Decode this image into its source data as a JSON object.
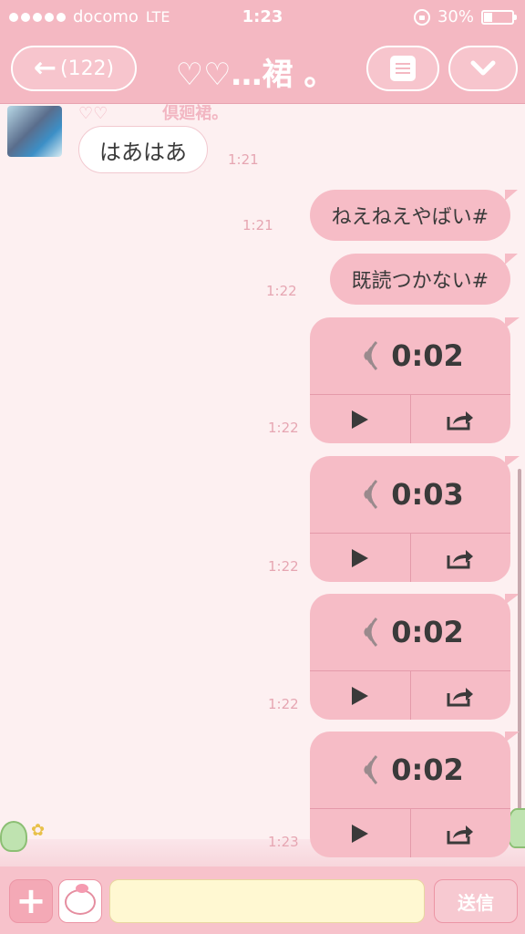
{
  "status_bar": {
    "carrier": "docomo",
    "network": "LTE",
    "time": "1:23",
    "battery": "30%",
    "battery_level": 0.3
  },
  "nav": {
    "back_label": "(122)",
    "title": "♡♡…裙 。"
  },
  "chat": {
    "sender_name_left": "♡♡",
    "sender_name_right": "倶廻裙。",
    "incoming": {
      "text": "はあはあ",
      "time": "1:21"
    },
    "outgoing_text": [
      {
        "text": "ねえねえやばい#",
        "time": "1:21"
      },
      {
        "text": "既読つかない#",
        "time": "1:22"
      }
    ],
    "voice_messages": [
      {
        "duration": "0:02",
        "time": "1:22"
      },
      {
        "duration": "0:03",
        "time": "1:22"
      },
      {
        "duration": "0:02",
        "time": "1:22"
      },
      {
        "duration": "0:02",
        "time": "1:23"
      }
    ]
  },
  "input_bar": {
    "placeholder": "",
    "send_label": "送信"
  },
  "colors": {
    "header": "#f4b8c2",
    "bubble_out": "#f6bcc6",
    "input_bg": "#fff8d2"
  }
}
